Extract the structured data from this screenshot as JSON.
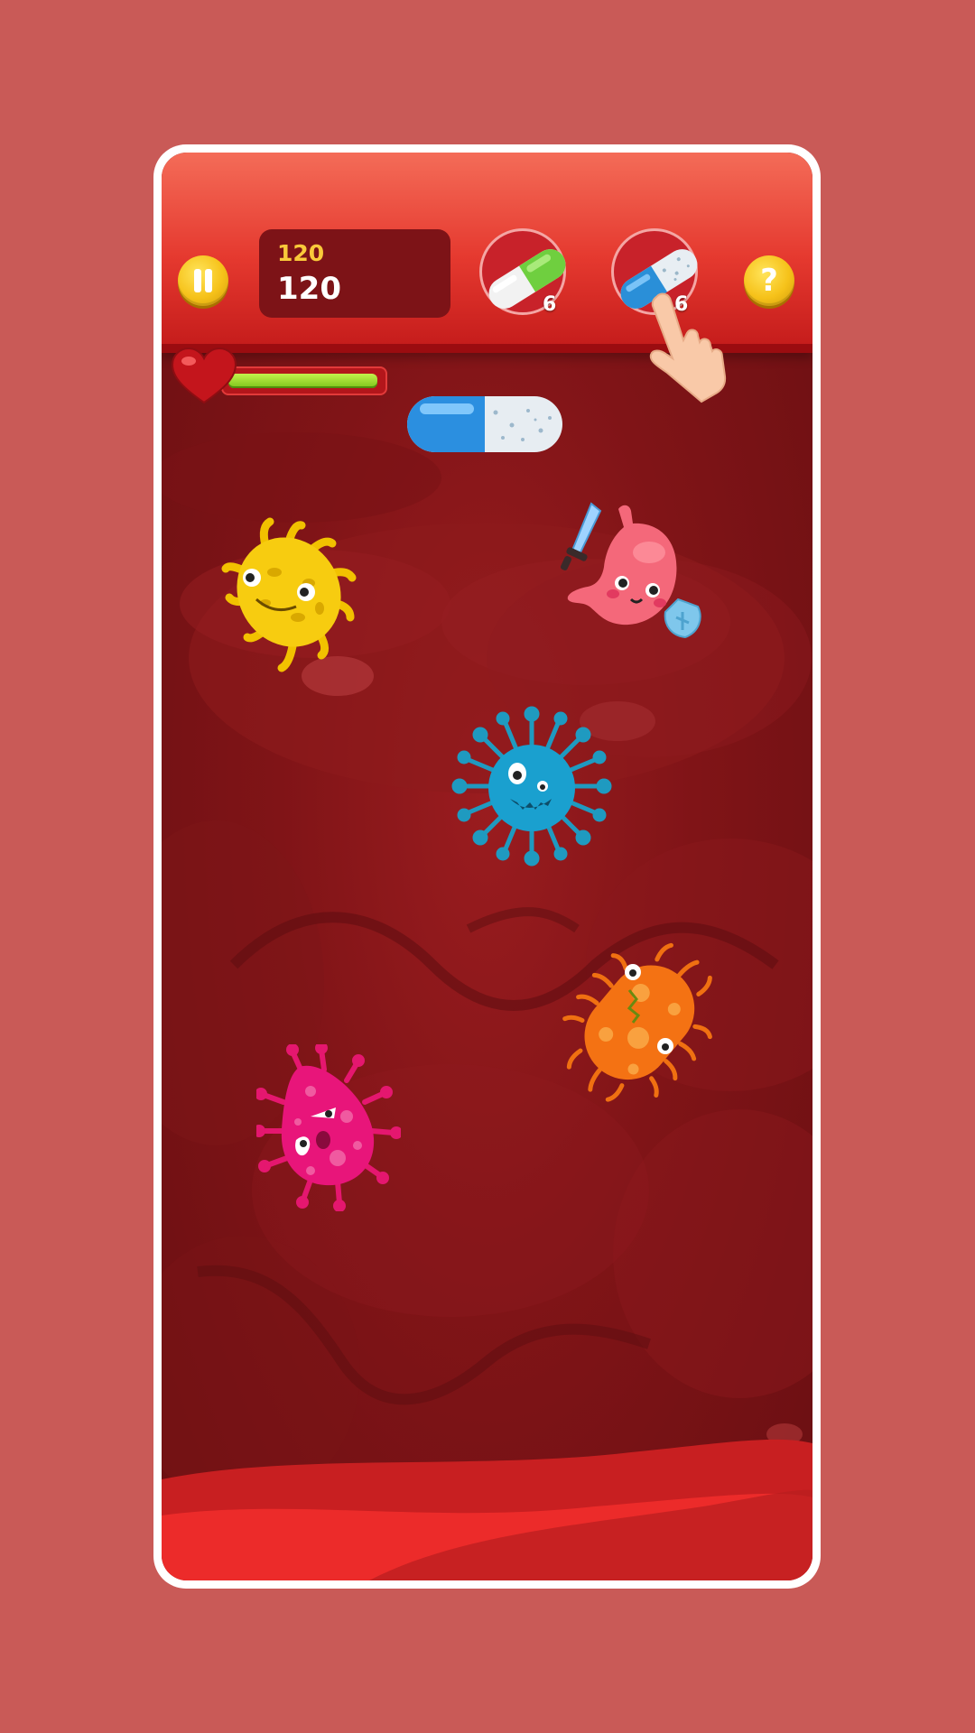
{
  "hud": {
    "best_score": "120",
    "current_score": "120",
    "help_label": "?"
  },
  "pills": {
    "green_count": "6",
    "blue_count": "6"
  },
  "health": {
    "level_percent": 98
  },
  "colors": {
    "background": "#c95a57",
    "topbar": "#e5392f",
    "score_panel": "#7d1317",
    "gold_button": "#f6c21a",
    "health_green": "#7cc41a"
  },
  "icons": [
    "pause-icon",
    "question-icon",
    "green-pill-icon",
    "blue-pill-icon",
    "heart-icon",
    "tap-hand-icon",
    "stomach-hero-icon",
    "yellow-germ-icon",
    "blue-virus-icon",
    "orange-bacteria-icon",
    "pink-germ-icon"
  ]
}
